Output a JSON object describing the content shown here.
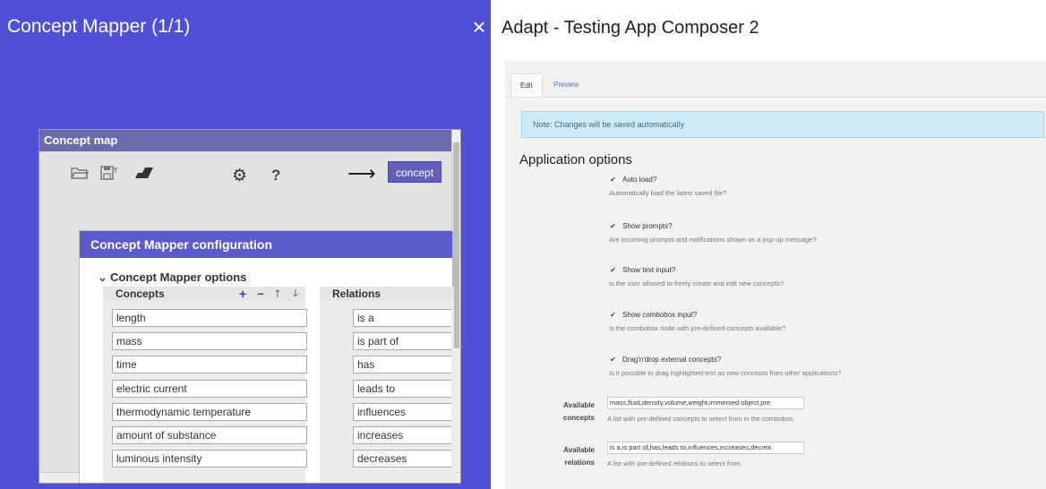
{
  "left": {
    "title": "Concept Mapper (1/1)",
    "close_icon": "close-icon",
    "concept_map": {
      "title": "Concept map",
      "toolbar": {
        "icons": [
          "folder-open-icon",
          "save-icon",
          "eraser-icon",
          "gear-icon",
          "help-icon",
          "arrow-right-icon"
        ],
        "help_label": "?",
        "concept_button": "concept"
      },
      "config": {
        "title": "Concept Mapper configuration",
        "section": "Concept Mapper options",
        "concepts_header": "Concepts",
        "relations_header": "Relations",
        "concepts": [
          "length",
          "mass",
          "time",
          "electric current",
          "thermodynamic temperature",
          "amount of substance",
          "luminous intensity"
        ],
        "relations": [
          "is a",
          "is part of",
          "has",
          "leads to",
          "influences",
          "increases",
          "decreases"
        ]
      }
    }
  },
  "right": {
    "title": "Adapt - Testing App Composer 2",
    "tabs": [
      {
        "label": "Edit",
        "active": true
      },
      {
        "label": "Preview",
        "active": false
      }
    ],
    "note": "Note: Changes will be saved automatically",
    "section_title": "Application options",
    "options": [
      {
        "label": "Auto load?",
        "help": "Automatically load the latest saved file?",
        "checked": true
      },
      {
        "label": "Show prompts?",
        "help": "Are incoming prompts and notifications shown as a pop-up message?",
        "checked": true
      },
      {
        "label": "Show text input?",
        "help": "Is the user allowed to freely create and edit new concepts?",
        "checked": true
      },
      {
        "label": "Show combobox input?",
        "help": "Is the combobox node with pre-defined concepts available?",
        "checked": true
      },
      {
        "label": "Drag'n'drop external concepts?",
        "help": "Is it possible to drag highlighted text as new concepts from other applications?",
        "checked": true
      }
    ],
    "fields": [
      {
        "label_line1": "Available",
        "label_line2": "concepts",
        "value": "mass,fluid,density,volume,weight,immersed object,pre",
        "help": "A list with pre-defined concepts to select from in the combobox."
      },
      {
        "label_line1": "Available",
        "label_line2": "relations",
        "value": "is a,is part of,has,leads to,influences,increases,decrea",
        "help": "A list with pre-defined relations to select from."
      }
    ],
    "check_glyph": "✔"
  },
  "colors": {
    "left_bg": "#5050d6",
    "config_header": "#5b5bcc",
    "concept_button": "#6060b8",
    "note_bg": "#cfe9f5"
  }
}
